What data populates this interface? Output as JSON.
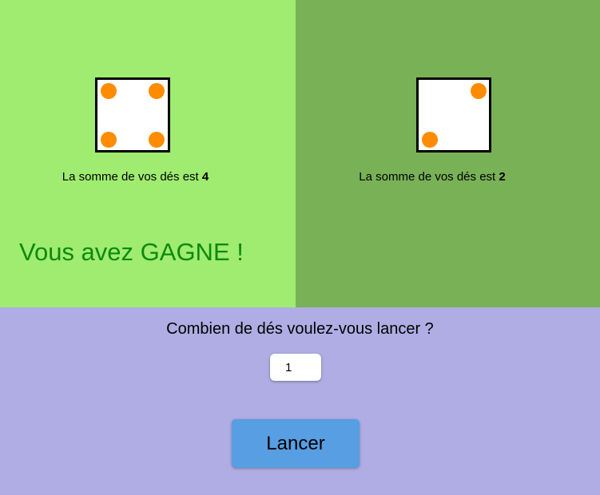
{
  "colors": {
    "player_panel_bg": "#9fec70",
    "opponent_panel_bg": "#79b157",
    "controls_bg": "#afade3",
    "pip": "#ff8c00",
    "win_text": "#0d8a0d",
    "button_bg": "#579ee2"
  },
  "player": {
    "die_value": 4,
    "sum_prefix": "La somme de vos dés est",
    "sum_value": "4",
    "result": "Vous avez GAGNE !"
  },
  "opponent": {
    "die_value": 2,
    "sum_prefix": "La somme de vos dés est",
    "sum_value": "2"
  },
  "controls": {
    "question": "Combien de dés voulez-vous lancer ?",
    "dice_count": "1",
    "roll_label": "Lancer"
  }
}
